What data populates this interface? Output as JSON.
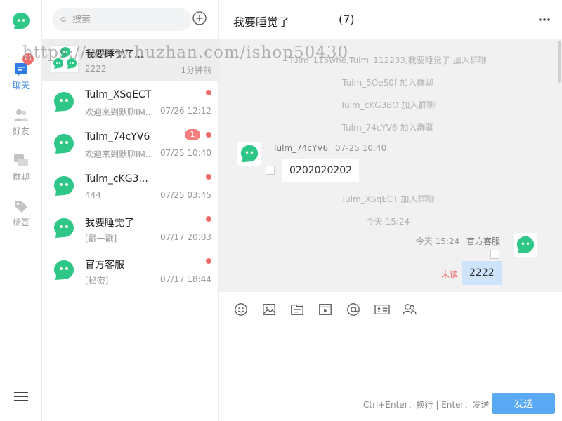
{
  "colors": {
    "brand": "#2fc788",
    "accent": "#2f7de1",
    "badge": "#f26b6b",
    "bubble_self": "#cde4fb"
  },
  "rail": {
    "badge": "11",
    "items": [
      {
        "label": "聊天",
        "icon": "chat-icon",
        "active": true
      },
      {
        "label": "好友",
        "icon": "friends-icon"
      },
      {
        "label": "群聊",
        "icon": "group-chat-icon"
      },
      {
        "label": "标签",
        "icon": "tag-icon"
      }
    ]
  },
  "search": {
    "placeholder": "搜索"
  },
  "conversations": [
    {
      "name": "我要睡觉了...",
      "preview": "2222",
      "time": "1分钟前"
    },
    {
      "name": "Tulm_XSqECT",
      "preview": "欢迎来到默聊IM...",
      "time": "07/26 12:12"
    },
    {
      "name": "Tulm_74cYV6",
      "preview": "欢迎来到默聊IM...",
      "time": "07/25 10:40",
      "count": "1"
    },
    {
      "name": "Tulm_cKG3...",
      "preview": "444",
      "time": "07/25 03:45"
    },
    {
      "name": "我要睡觉了",
      "preview": "[戳一戳]",
      "time": "07/17 20:03"
    },
    {
      "name": "官方客服",
      "preview": "[秘密]",
      "time": "07/17 18:44"
    }
  ],
  "chat": {
    "title": "我要睡觉了",
    "count": "(7)",
    "system_messages": [
      "Tulm_115whe,Tulm_112233,我要睡觉了 加入群聊",
      "Tulm_5OeS0f 加入群聊",
      "Tulm_cKG3BO 加入群聊",
      "Tulm_74cYV6 加入群聊",
      "Tulm_XSqECT 加入群聊",
      "今天 15:24"
    ],
    "msg_left": {
      "sender": "Tulm_74cYV6",
      "time": "07-25 10:40",
      "text": "0202020202"
    },
    "msg_right": {
      "sender": "官方客服",
      "time": "今天 15:24",
      "text": "2222",
      "status": "未读"
    },
    "tools": [
      "emoji-icon",
      "image-icon",
      "file-icon",
      "video-icon",
      "mention-icon",
      "card-icon",
      "contact-icon"
    ],
    "hint": "Ctrl+Enter：换行 | Enter：发送",
    "send_label": "发送"
  },
  "watermark": "https://www.huzhan.com/ishop50430"
}
